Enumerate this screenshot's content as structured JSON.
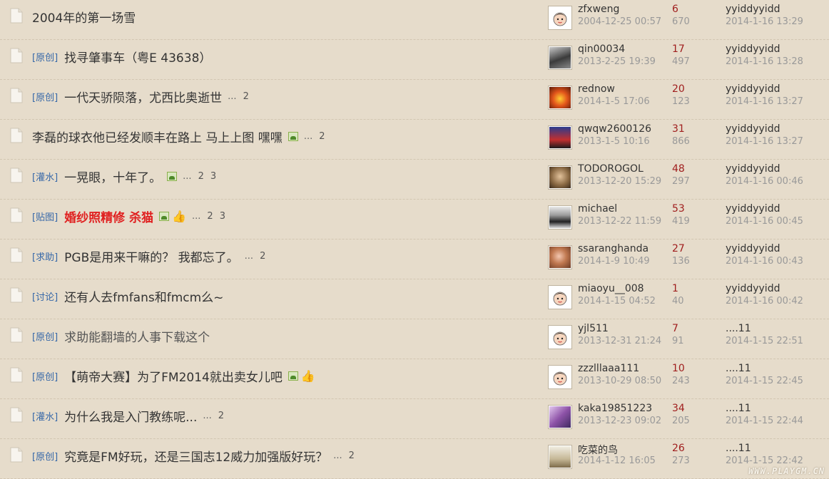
{
  "threads": [
    {
      "tag": "",
      "title": "2004年的第一场雪",
      "style": "normal",
      "image": false,
      "thumb": false,
      "pages": [],
      "author": "zfxweng",
      "date": "2004-12-25 00:57",
      "replies": "6",
      "views": "670",
      "last_user": "yyiddyyidd",
      "last_date": "2014-1-16 13:29",
      "avatar": "default"
    },
    {
      "tag": "[原创]",
      "title": "找寻肇事车（粤E 43638）",
      "style": "normal",
      "image": false,
      "thumb": false,
      "pages": [],
      "author": "qin00034",
      "date": "2013-2-25 19:39",
      "replies": "17",
      "views": "497",
      "last_user": "yyiddyyidd",
      "last_date": "2014-1-16 13:28",
      "avatar": "photo-person"
    },
    {
      "tag": "[原创]",
      "title": "一代天骄陨落，尤西比奥逝世",
      "style": "normal",
      "image": false,
      "thumb": false,
      "pages": [
        "2"
      ],
      "author": "rednow",
      "date": "2014-1-5 17:06",
      "replies": "20",
      "views": "123",
      "last_user": "yyiddyyidd",
      "last_date": "2014-1-16 13:27",
      "avatar": "photo-fire"
    },
    {
      "tag": "",
      "title": "李磊的球衣他已经发顺丰在路上 马上上图 嘿嘿",
      "style": "normal",
      "image": true,
      "thumb": false,
      "pages": [
        "2"
      ],
      "author": "qwqw2600126",
      "date": "2013-1-5 10:16",
      "replies": "31",
      "views": "866",
      "last_user": "yyiddyyidd",
      "last_date": "2014-1-16 13:27",
      "avatar": "photo-player"
    },
    {
      "tag": "[灌水]",
      "title": "一晃眼，十年了。",
      "style": "normal",
      "image": true,
      "thumb": false,
      "pages": [
        "2",
        "3"
      ],
      "author": "TODOROGOL",
      "date": "2013-12-20 15:29",
      "replies": "48",
      "views": "297",
      "last_user": "yyiddyyidd",
      "last_date": "2014-1-16 00:46",
      "avatar": "photo-face"
    },
    {
      "tag": "[贴图]",
      "title": "婚纱照精修 杀猫",
      "style": "highlight",
      "image": true,
      "thumb": true,
      "pages": [
        "2",
        "3"
      ],
      "author": "michael",
      "date": "2013-12-22 11:59",
      "replies": "53",
      "views": "419",
      "last_user": "yyiddyyidd",
      "last_date": "2014-1-16 00:45",
      "avatar": "photo-dancer"
    },
    {
      "tag": "[求助]",
      "title": "PGB是用来干嘛的？ 我都忘了。",
      "style": "normal",
      "image": false,
      "thumb": false,
      "pages": [
        "2"
      ],
      "author": "ssaranghanda",
      "date": "2014-1-9 10:49",
      "replies": "27",
      "views": "136",
      "last_user": "yyiddyyidd",
      "last_date": "2014-1-16 00:43",
      "avatar": "photo-girl"
    },
    {
      "tag": "[讨论]",
      "title": "还有人去fmfans和fmcm么~",
      "style": "normal",
      "image": false,
      "thumb": false,
      "pages": [],
      "author": "miaoyu__008",
      "date": "2014-1-15 04:52",
      "replies": "1",
      "views": "40",
      "last_user": "yyiddyyidd",
      "last_date": "2014-1-16 00:42",
      "avatar": "default"
    },
    {
      "tag": "[原创]",
      "title": "求助能翻墙的人事下载这个",
      "style": "gray",
      "image": false,
      "thumb": false,
      "pages": [],
      "author": "yjl511",
      "date": "2013-12-31 21:24",
      "replies": "7",
      "views": "91",
      "last_user": "....11",
      "last_date": "2014-1-15 22:51",
      "avatar": "default"
    },
    {
      "tag": "[原创]",
      "title": "【萌帝大赛】为了FM2014就出卖女儿吧",
      "style": "normal",
      "image": true,
      "thumb": true,
      "pages": [],
      "author": "zzzlllaaa111",
      "date": "2013-10-29 08:50",
      "replies": "10",
      "views": "243",
      "last_user": "....11",
      "last_date": "2014-1-15 22:45",
      "avatar": "default"
    },
    {
      "tag": "[灌水]",
      "title": "为什么我是入门教练呢...",
      "style": "normal",
      "image": false,
      "thumb": false,
      "pages": [
        "2"
      ],
      "author": "kaka19851223",
      "date": "2013-12-23 09:02",
      "replies": "34",
      "views": "205",
      "last_user": "....11",
      "last_date": "2014-1-15 22:44",
      "avatar": "photo-purple"
    },
    {
      "tag": "[原创]",
      "title": "究竟是FM好玩，还是三国志12威力加强版好玩？",
      "style": "normal",
      "image": false,
      "thumb": false,
      "pages": [
        "2"
      ],
      "author": "吃菜的鸟",
      "date": "2014-1-12 16:05",
      "replies": "26",
      "views": "273",
      "last_user": "....11",
      "last_date": "2014-1-15 22:42",
      "avatar": "photo-bird"
    }
  ],
  "pager_dots": "...",
  "watermark": "WWW.PLAYGM.CN",
  "colors": {
    "background": "#e6dccb",
    "tag": "#3567a8",
    "replies": "#a01e1e",
    "highlight": "#e02020"
  }
}
